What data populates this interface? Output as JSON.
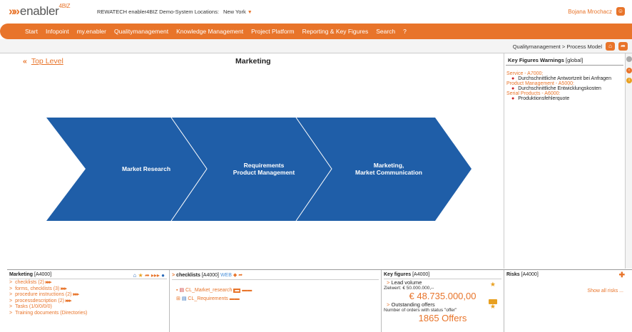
{
  "header": {
    "logo": "enabler",
    "logo_sup": "4BIZ",
    "system": "REWATECH enabler4BIZ Demo-System",
    "locations_label": "Locations:",
    "location": "New York",
    "user": "Bojana Mrochacz"
  },
  "nav": {
    "items": [
      "Start",
      "Infopoint",
      "my.enabler",
      "Qualitymanagement",
      "Knowledge Management",
      "Project Platform",
      "Reporting & Key Figures",
      "Search",
      "?"
    ]
  },
  "breadcrumb": "Qualitymanagement > Process Model",
  "main": {
    "top_level": "Top Level",
    "title": "Marketing",
    "process_steps": [
      {
        "label": "Market Research"
      },
      {
        "label": "Requirements\nProduct Management"
      },
      {
        "label": "Marketing,\nMarket Communication"
      }
    ],
    "chevron_color": "#1f5ea8"
  },
  "key_figures_warnings": {
    "title": "Key Figures Warnings",
    "scope": "[global]",
    "groups": [
      {
        "name": "Service - A7000:",
        "items": [
          "Durchschnittliche Antwortzeit bei Anfragen"
        ]
      },
      {
        "name": "Product Management - A5000:",
        "items": [
          "Durchschnittliche Entwicklungskosten"
        ]
      },
      {
        "name": "Serial Products - A6000:",
        "items": [
          "Produktionsfehlerquote"
        ]
      }
    ]
  },
  "panels": {
    "marketing": {
      "title": "Marketing",
      "code": "[A4000]",
      "rows": [
        "checklists (2)",
        "forms, checklists (3)",
        "procedure instructions (2)",
        "processdescription (2)",
        "Tasks (1/0/0/0/0)",
        "Training documents (Directories)"
      ]
    },
    "checklists": {
      "title": "checklists",
      "code": "[A4000]",
      "web": "WEB",
      "items": [
        "CL_Market_research",
        "CL_Requirements"
      ]
    },
    "key_figures": {
      "title": "Key figures",
      "code": "[A4000]",
      "kf1_title": "Lead volume",
      "kf1_target": "Zielwert: € 50.000.000,--",
      "kf1_value": "€ 48.735.000,00",
      "kf2_title": "Outstanding offers",
      "kf2_sub": "Number of orders with status \"offer\"",
      "kf2_value": "1865 Offers"
    },
    "risks": {
      "title": "Risks",
      "code": "[A4000]",
      "show_all": "Show all risks ..."
    }
  },
  "colors": {
    "accent": "#e8742a",
    "chevron": "#1f5ea8"
  }
}
